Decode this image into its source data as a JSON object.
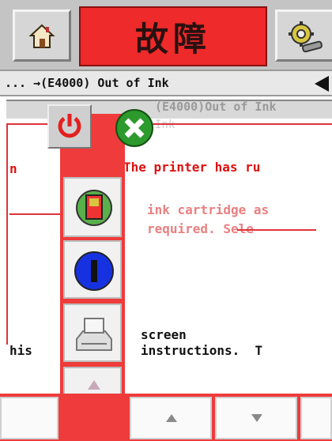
{
  "header": {
    "title": "故障",
    "home_icon": "home-icon",
    "tools_icon": "settings-gear-icon"
  },
  "status_bar": {
    "text": "... →(E4000) Out of Ink"
  },
  "message": {
    "ghost_header": "(E4000)Out of Ink",
    "ghost_sub": "Ink",
    "line1": "The printer has ru",
    "line2": "ink cartridge as",
    "line3": "required. Sele",
    "line4": "screen",
    "line5": "instructions.  T",
    "left_fragment_1": "n",
    "left_fragment_2": "his"
  },
  "popup": {
    "icons": [
      "power-icon",
      "close-icon",
      "ink-cartridge-icon",
      "info-icon",
      "printer-icon",
      "navigation-arrows-icon"
    ]
  },
  "colors": {
    "accent_red": "#ef3b3b",
    "title_red": "#ee2a2a",
    "text_red": "#dd1111",
    "header_gray": "#c4c4c4"
  }
}
